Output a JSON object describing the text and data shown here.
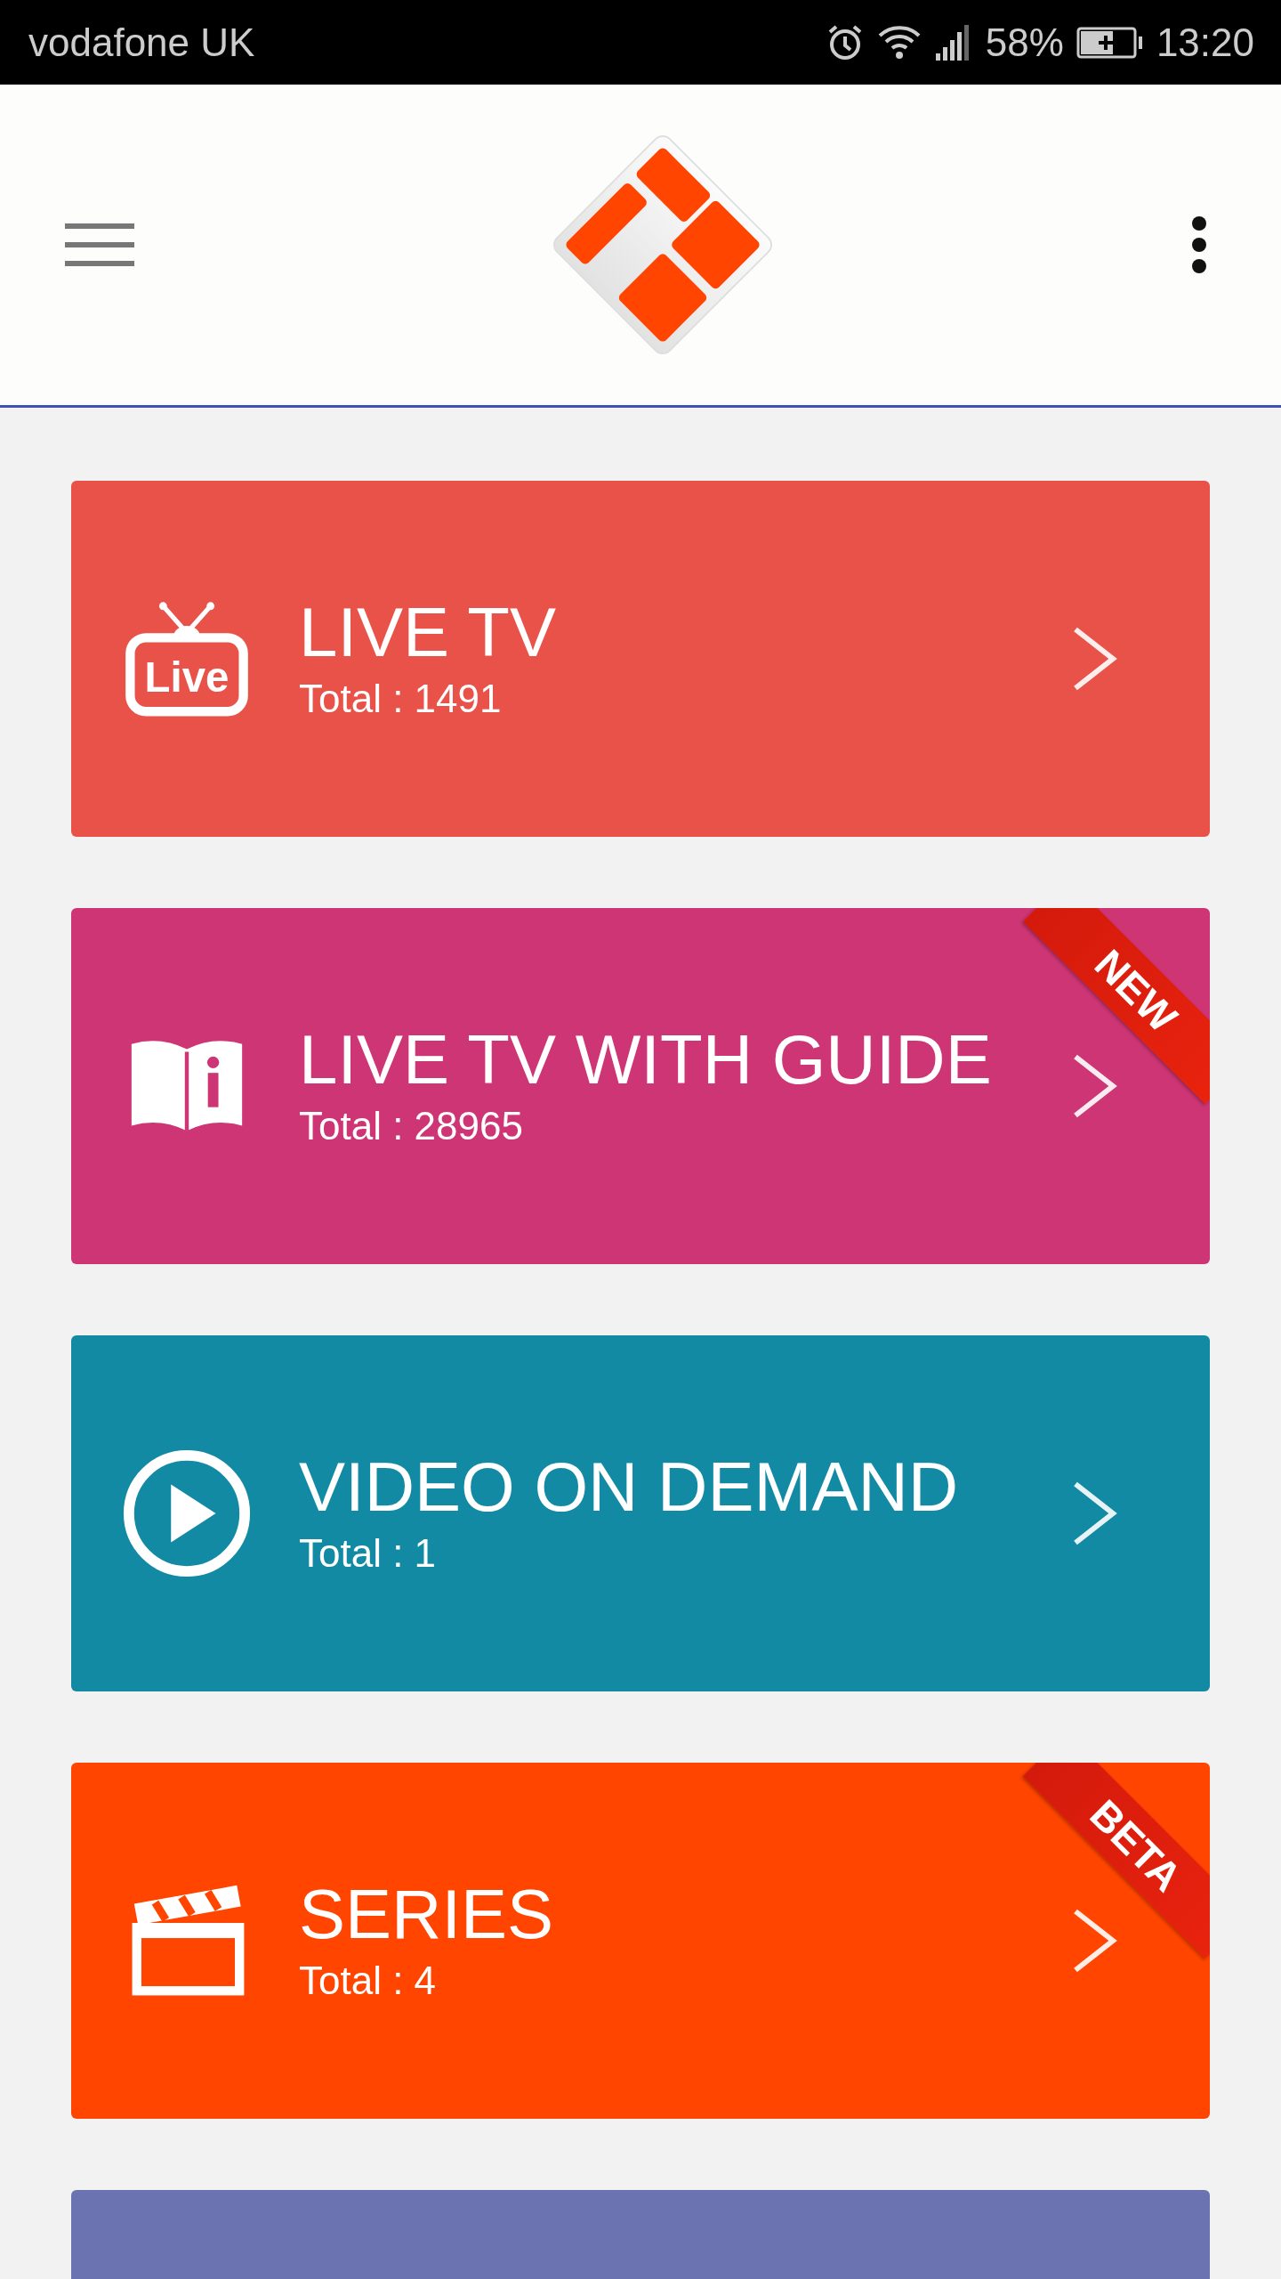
{
  "status_bar": {
    "carrier": "vodafone UK",
    "battery": "58%",
    "time": "13:20"
  },
  "cards": [
    {
      "kind": "live",
      "icon_text": "Live",
      "title": "LIVE TV",
      "total": "Total : 1491",
      "color": "#e95248"
    },
    {
      "kind": "guide",
      "title": "LIVE TV WITH GUIDE",
      "total": "Total : 28965",
      "color": "#cd3575",
      "ribbon": "NEW"
    },
    {
      "kind": "play",
      "title": "VIDEO ON DEMAND",
      "total": "Total : 1",
      "color": "#138aa4"
    },
    {
      "kind": "series",
      "title": "SERIES",
      "total": "Total : 4",
      "color": "#ff4500",
      "ribbon": "BETA"
    },
    {
      "color": "#6b74b0"
    }
  ]
}
